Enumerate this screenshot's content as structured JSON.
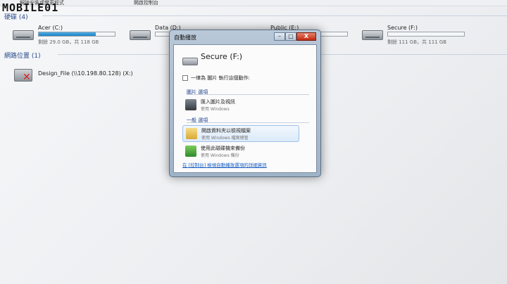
{
  "watermark": "MOBILE01",
  "topbar": {
    "items": [
      "解除安裝或變更程式",
      "開啟控制台"
    ]
  },
  "hard_drives": {
    "header": "硬碟 (4)",
    "items": [
      {
        "name": "Acer (C:)",
        "free": "剩餘 29.0 GB，共 118 GB",
        "usage_fraction": 0.75
      },
      {
        "name": "Data (D:)",
        "free": "",
        "usage_fraction": 0.0
      },
      {
        "name": "Public (E:)",
        "free": "",
        "usage_fraction": 0.0
      },
      {
        "name": "Secure (F:)",
        "free": "剩餘 111 GB，共 111 GB",
        "usage_fraction": 0.0
      }
    ]
  },
  "network": {
    "header": "網路位置 (1)",
    "items": [
      {
        "name": "Design_File (\\\\10.198.80.128) (X:)"
      }
    ]
  },
  "dialog": {
    "title": "自動播放",
    "device": "Secure (F:)",
    "always_label": "一律為 圖片 執行這個動作:",
    "picture_header": "圖片 選項",
    "general_header": "一般 選項",
    "options": [
      {
        "title": "匯入圖片及視訊",
        "subtitle": "使用 Windows"
      },
      {
        "title": "開啟資料夾以檢視檔案",
        "subtitle": "使用 Windows 檔案總管"
      },
      {
        "title": "使用此磁碟機來備份",
        "subtitle": "使用 Windows 備份"
      }
    ],
    "link": "在 [控制台] 檢視自動播放選項的詳細資訊",
    "title_buttons": [
      "–",
      "□",
      "X"
    ]
  }
}
